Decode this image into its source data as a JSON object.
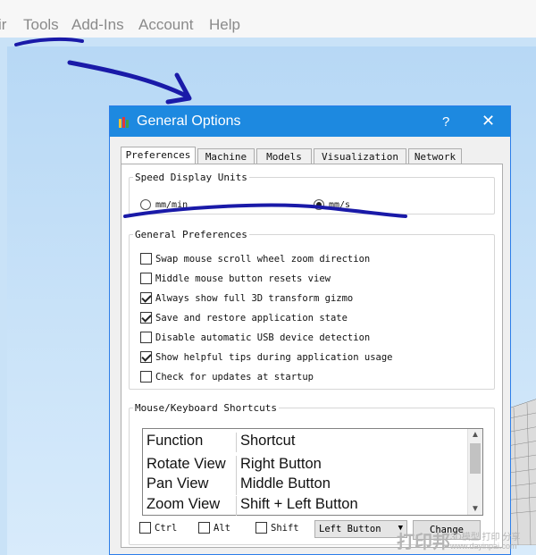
{
  "menu": {
    "partial": "ir",
    "tools": "Tools",
    "addins": "Add-Ins",
    "account": "Account",
    "help": "Help"
  },
  "dialog": {
    "title": "General Options",
    "help_label": "?",
    "close_label": "✕",
    "tabs": [
      "Preferences",
      "Machine",
      "Models",
      "Visualization",
      "Network"
    ],
    "active_tab": "Preferences",
    "speed_units": {
      "legend": "Speed Display Units",
      "options": [
        {
          "label": "mm/min",
          "selected": false
        },
        {
          "label": "mm/s",
          "selected": true
        }
      ]
    },
    "general": {
      "legend": "General Preferences",
      "items": [
        {
          "label": "Swap mouse scroll wheel zoom direction",
          "checked": false
        },
        {
          "label": "Middle mouse button resets view",
          "checked": false
        },
        {
          "label": "Always show full 3D transform gizmo",
          "checked": true
        },
        {
          "label": "Save and restore application state",
          "checked": true
        },
        {
          "label": "Disable automatic USB device detection",
          "checked": false
        },
        {
          "label": "Show helpful tips during application usage",
          "checked": true
        },
        {
          "label": "Check for updates at startup",
          "checked": false
        }
      ]
    },
    "shortcuts": {
      "legend": "Mouse/Keyboard Shortcuts",
      "headers": [
        "Function",
        "Shortcut"
      ],
      "rows": [
        [
          "Rotate View",
          "Right Button"
        ],
        [
          "Pan View",
          "Middle Button"
        ],
        [
          "Zoom View",
          "Shift + Left Button"
        ]
      ],
      "modifiers": [
        {
          "label": "Ctrl",
          "checked": false
        },
        {
          "label": "Alt",
          "checked": false
        },
        {
          "label": "Shift",
          "checked": false
        }
      ],
      "button_select": "Left Button",
      "change_label": "Change"
    }
  },
  "watermark": {
    "big": "打印邦",
    "small": "3D模型 打印 分享",
    "url": "www.dayinpai.com"
  },
  "colors": {
    "titlebar": "#1d89e0",
    "annotation": "#1a1aa8"
  }
}
